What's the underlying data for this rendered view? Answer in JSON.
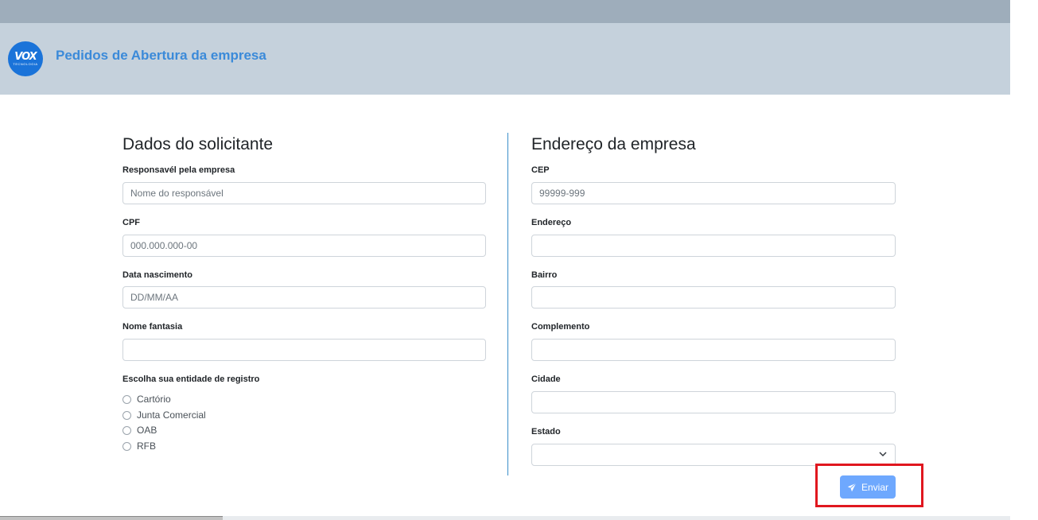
{
  "header": {
    "logo_big": "VOX",
    "logo_small": "TECNOLOGIA",
    "title": "Pedidos de Abertura da empresa"
  },
  "left": {
    "title": "Dados do solicitante",
    "responsavel_label": "Responsavél pela empresa",
    "responsavel_placeholder": "Nome do responsável",
    "cpf_label": "CPF",
    "cpf_placeholder": "000.000.000-00",
    "nascimento_label": "Data nascimento",
    "nascimento_placeholder": "DD/MM/AA",
    "fantasia_label": "Nome fantasia",
    "entidade_label": "Escolha sua entidade de registro",
    "options": [
      "Cartório",
      "Junta Comercial",
      "OAB",
      "RFB"
    ]
  },
  "right": {
    "title": "Endereço da empresa",
    "cep_label": "CEP",
    "cep_placeholder": "99999-999",
    "endereco_label": "Endereço",
    "bairro_label": "Bairro",
    "complemento_label": "Complemento",
    "cidade_label": "Cidade",
    "estado_label": "Estado"
  },
  "submit_label": "Enviar",
  "colors": {
    "accent": "#3b8ad9",
    "button": "#6ea8fe",
    "highlight": "#e0171f"
  }
}
